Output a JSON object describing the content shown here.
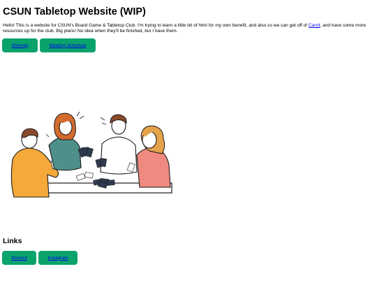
{
  "header": {
    "title": "CSUN Tabletop Website (WIP)"
  },
  "intro": {
    "before_link": "Hello! This is a website for CSUN's Board Game & Tabletop Club. I'm trying to learn a little bit of html for my own benefit, and also so we can get off of ",
    "link_text": "Carrd",
    "after_link": ", and have some more resources up for the club. Big plans! No idea when they'll be finished, but I have them."
  },
  "nav": {
    "sitemap_label": "Sitemap",
    "meeting_label": "Meeting Schedule"
  },
  "links_section": {
    "heading": "Links",
    "discord_label": "Discord",
    "instagram_label": "Instagram"
  },
  "colors": {
    "button_bg": "#0aa36b",
    "link": "#0000ee"
  }
}
